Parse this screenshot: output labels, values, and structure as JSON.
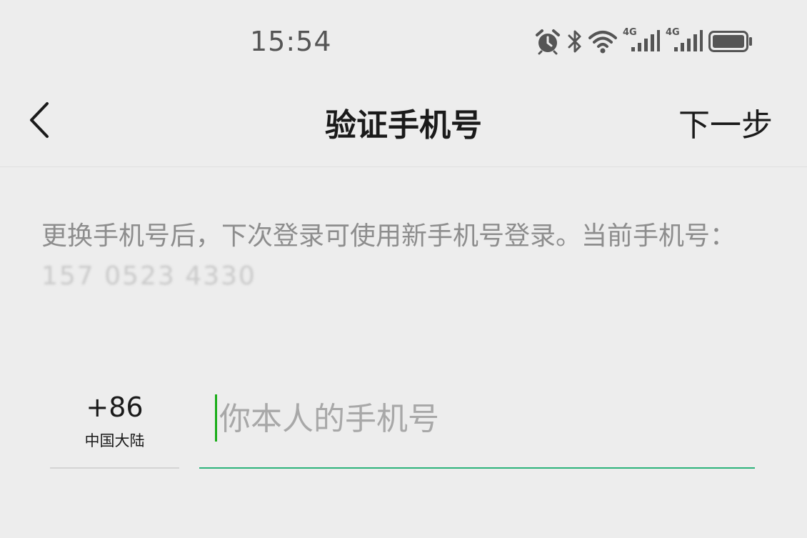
{
  "status_bar": {
    "time": "15:54",
    "icons": [
      "alarm-icon",
      "bluetooth-icon",
      "wifi-icon",
      "signal-4g-icon",
      "signal-4g-icon",
      "battery-icon"
    ],
    "network_1": "4G",
    "network_2": "4G",
    "battery_level": 1.0
  },
  "nav": {
    "title": "验证手机号",
    "next_label": "下一步",
    "back_icon": "chevron-left-icon"
  },
  "description": {
    "text_prefix": "更换手机号后，下次登录可使用新手机号登录。当前手机号：",
    "current_phone": "157 0523 4330"
  },
  "country": {
    "code": "+86",
    "region": "中国大陆"
  },
  "phone_input": {
    "placeholder": "你本人的手机号",
    "value": ""
  },
  "colors": {
    "background": "#ededed",
    "accent": "#2db37b",
    "caret": "#1aad19",
    "muted_text": "#8d8d8d"
  }
}
